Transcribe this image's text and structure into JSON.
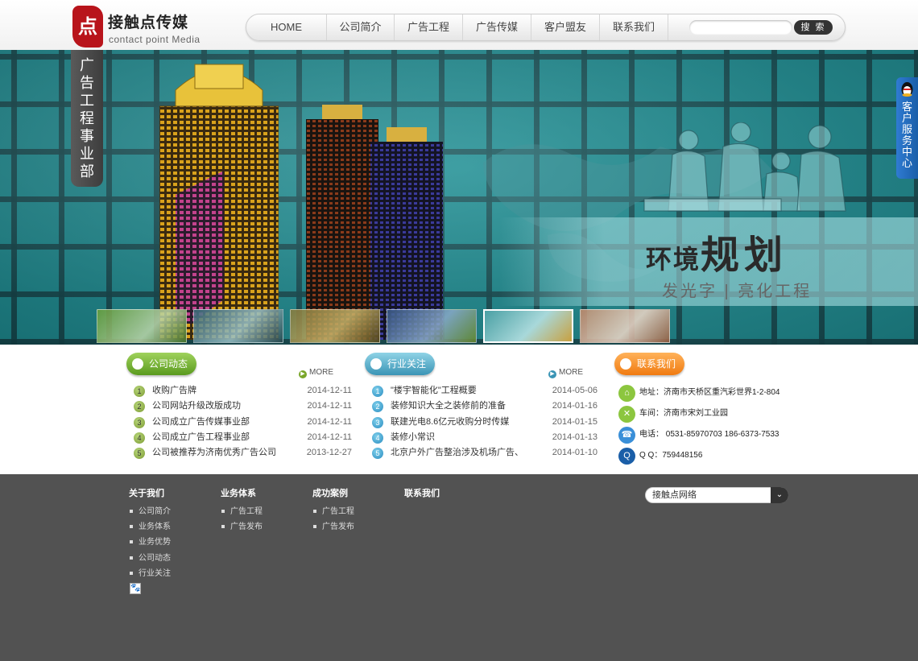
{
  "header": {
    "logo_seal": "点",
    "logo_title": "接触点传媒",
    "logo_subtitle": "contact point Media",
    "nav": [
      {
        "label": "HOME"
      },
      {
        "label": "公司简介"
      },
      {
        "label": "广告工程"
      },
      {
        "label": "广告传媒"
      },
      {
        "label": "客户盟友"
      },
      {
        "label": "联系我们"
      }
    ],
    "search": {
      "placeholder": "",
      "button": "搜 索"
    }
  },
  "banner": {
    "vertical_tab": [
      "广",
      "告",
      "工",
      "程",
      "事",
      "业",
      "部"
    ],
    "slogan_small": "环境",
    "slogan_big": "规划",
    "slogan_sub": "发光字 | 亮化工程",
    "active_thumb_index": 4,
    "thumb_count": 6
  },
  "service_tab": {
    "chars": [
      "客",
      "户",
      "服",
      "务",
      "中",
      "心"
    ]
  },
  "sections": {
    "company_news": {
      "title": "公司动态",
      "more": "MORE",
      "items": [
        {
          "num": "1",
          "title": "收购广告牌",
          "date": "2014-12-11"
        },
        {
          "num": "2",
          "title": "公司网站升级改版成功",
          "date": "2014-12-11"
        },
        {
          "num": "3",
          "title": "公司成立广告传媒事业部",
          "date": "2014-12-11"
        },
        {
          "num": "4",
          "title": "公司成立广告工程事业部",
          "date": "2014-12-11"
        },
        {
          "num": "5",
          "title": "公司被推荐为济南优秀广告公司",
          "date": "2013-12-27"
        }
      ]
    },
    "industry_news": {
      "title": "行业关注",
      "more": "MORE",
      "items": [
        {
          "num": "1",
          "title": "\"楼宇智能化\"工程概要",
          "date": "2014-05-06"
        },
        {
          "num": "2",
          "title": "装修知识大全之装修前的准备",
          "date": "2014-01-16"
        },
        {
          "num": "3",
          "title": "联建光电8.6亿元收购分时传媒",
          "date": "2014-01-15"
        },
        {
          "num": "4",
          "title": "装修小常识",
          "date": "2014-01-13"
        },
        {
          "num": "5",
          "title": "北京户外广告整治涉及机场广告、",
          "date": "2014-01-10"
        }
      ]
    },
    "contact": {
      "title": "联系我们",
      "items": [
        {
          "icon": "home-icon",
          "text": "地址：济南市天桥区重汽彩世界1-2-804"
        },
        {
          "icon": "tools-icon",
          "text": "车间：济南市宋刘工业园"
        },
        {
          "icon": "phone-icon",
          "text": "电话： 0531-85970703 186-6373-7533"
        },
        {
          "icon": "qq-icon",
          "text": "Q Q：759448156"
        }
      ]
    }
  },
  "footer": {
    "columns": [
      {
        "title": "关于我们",
        "items": [
          "公司简介",
          "业务体系",
          "业务优势",
          "公司动态",
          "行业关注"
        ]
      },
      {
        "title": "业务体系",
        "items": [
          "广告工程",
          "广告发布"
        ]
      },
      {
        "title": "成功案例",
        "items": [
          "广告工程",
          "广告发布"
        ]
      },
      {
        "title": "联系我们",
        "items": []
      }
    ],
    "select_value": "接触点网络"
  },
  "colors": {
    "nav_bg": "#f1f1f1",
    "banner_teal": "#1f8a8e",
    "green_pill": "#6aa62a",
    "blue_pill": "#3a94b5",
    "orange_pill": "#f07a10",
    "footer_bg": "#525252",
    "service_tab": "#1a5ea8"
  }
}
